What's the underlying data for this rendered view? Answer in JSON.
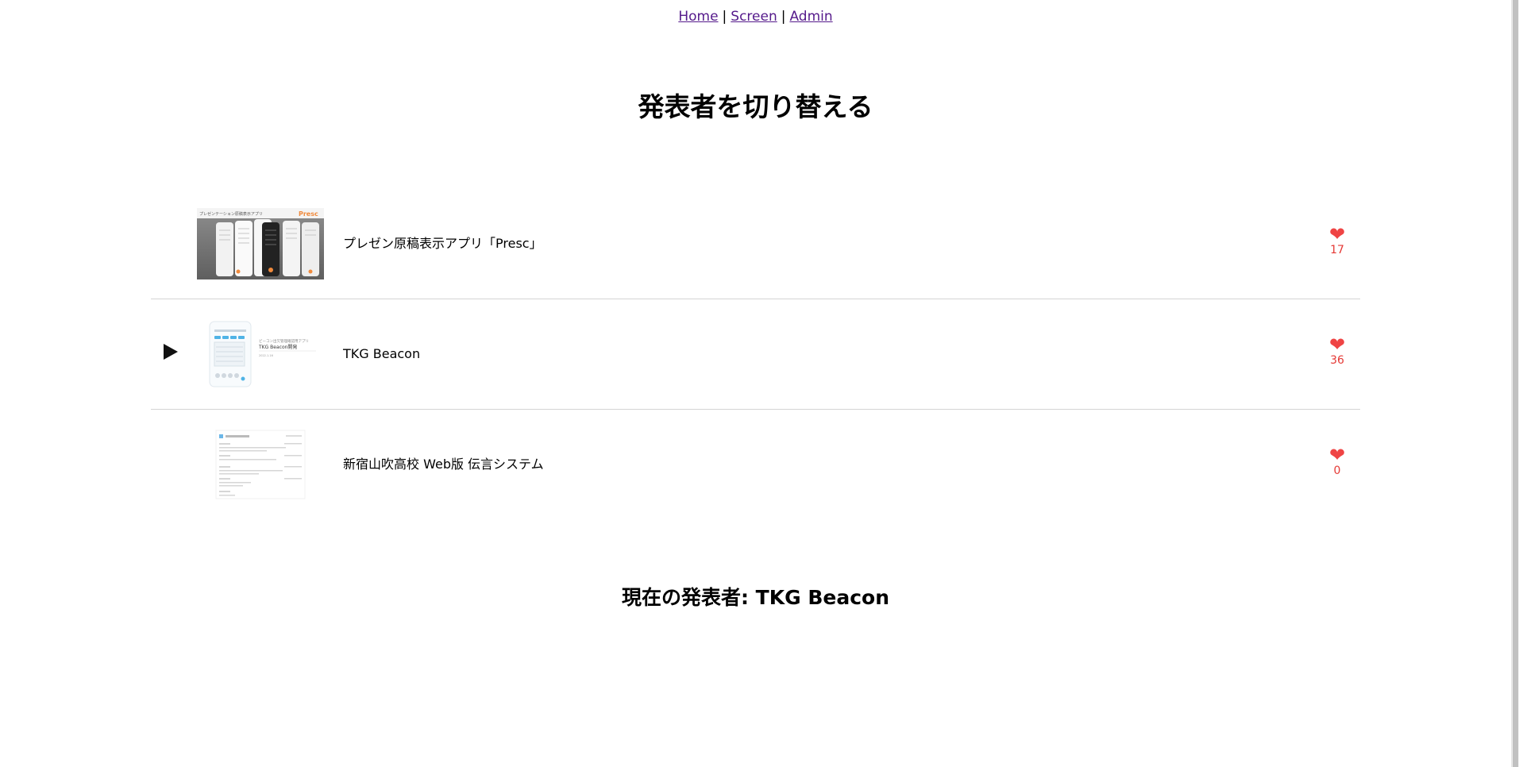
{
  "nav": {
    "home": "Home",
    "screen": "Screen",
    "admin": "Admin",
    "separator": "|"
  },
  "title": "発表者を切り替える",
  "presenters": [
    {
      "title": "プレゼン原稿表示アプリ「Presc」",
      "likes": "17",
      "playing": false,
      "thumbnail_icon": "presc-app-screenshot",
      "thumbnail_label_left": "プレゼンテーション原稿表示アプリ",
      "thumbnail_label_right": "Presc"
    },
    {
      "title": "TKG Beacon",
      "likes": "36",
      "playing": true,
      "thumbnail_icon": "tkg-beacon-slide",
      "thumbnail_caption_1": "ビーコン出欠管理確認用アプリ",
      "thumbnail_caption_2": "TKG Beacon開発",
      "thumbnail_caption_3": "2022.1.16"
    },
    {
      "title": "新宿山吹高校 Web版 伝言システム",
      "likes": "0",
      "playing": false,
      "thumbnail_icon": "message-system-document"
    }
  ],
  "current": "現在の発表者: TKG Beacon",
  "colors": {
    "heart": "#ef4444",
    "link": "#551a8b",
    "divider": "#d4d4d4"
  }
}
